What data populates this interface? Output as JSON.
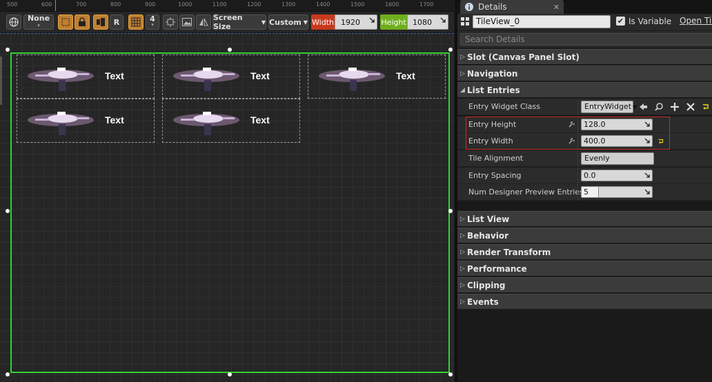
{
  "ruler": {
    "ticks": [
      "500",
      "600",
      "700",
      "800",
      "900",
      "1000",
      "1100",
      "1200",
      "1300",
      "1400",
      "1500",
      "1600",
      "1700"
    ]
  },
  "toolbar": {
    "locale_label": "None",
    "zoom_value": "4",
    "r_label": "R",
    "screen_size_label": "Screen Size",
    "custom_label": "Custom",
    "width_label": "Width",
    "width_value": "1920",
    "height_label": "Height",
    "height_value": "1080"
  },
  "canvas": {
    "entries": [
      {
        "text": "Text"
      },
      {
        "text": "Text"
      },
      {
        "text": "Text"
      },
      {
        "text": "Text"
      },
      {
        "text": "Text"
      }
    ]
  },
  "details": {
    "tab_title": "Details",
    "widget_name": "TileView_0",
    "is_variable_label": "Is Variable",
    "is_variable_checked": true,
    "open_link_label": "Open Tile",
    "search_placeholder": "Search Details",
    "categories": {
      "slot": "Slot (Canvas Panel Slot)",
      "navigation": "Navigation",
      "list_entries": "List Entries",
      "list_view": "List View",
      "behavior": "Behavior",
      "render_transform": "Render Transform",
      "performance": "Performance",
      "clipping": "Clipping",
      "events": "Events"
    },
    "props": {
      "entry_widget_class_label": "Entry Widget Class",
      "entry_widget_class_value": "EntryWidget",
      "entry_height_label": "Entry Height",
      "entry_height_value": "128.0",
      "entry_width_label": "Entry Width",
      "entry_width_value": "400.0",
      "tile_alignment_label": "Tile Alignment",
      "tile_alignment_value": "Evenly (Padding)",
      "entry_spacing_label": "Entry Spacing",
      "entry_spacing_value": "0.0",
      "num_preview_label": "Num Designer Preview Entries",
      "num_preview_value": "5"
    }
  },
  "colors": {
    "tileview_border": "#2fd42f",
    "highlight_box": "#cc2b2b",
    "width_badge": "#c83a1e",
    "height_badge": "#6fae1e",
    "toolbar_accent": "#c08030"
  }
}
